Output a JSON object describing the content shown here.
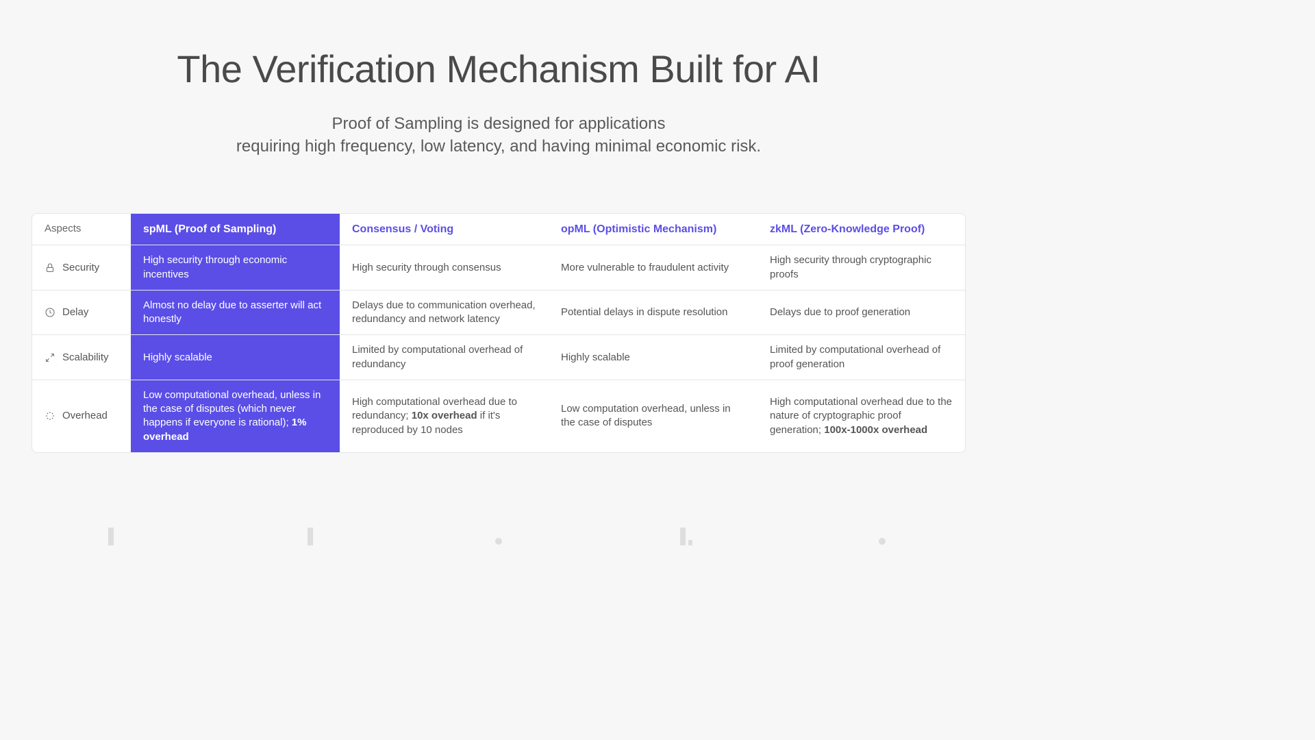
{
  "title": "The Verification Mechanism Built for AI",
  "subtitle_line1": "Proof of Sampling is designed for applications",
  "subtitle_line2": "requiring high frequency, low latency, and having minimal economic risk.",
  "table": {
    "header": {
      "aspects": "Aspects",
      "spml": "spML (Proof of Sampling)",
      "consensus": "Consensus / Voting",
      "opml": "opML (Optimistic Mechanism)",
      "zkml": "zkML (Zero-Knowledge Proof)"
    },
    "rows": {
      "security": {
        "label": "Security",
        "spml": "High security through economic incentives",
        "consensus": "High security through consensus",
        "opml": "More vulnerable to fraudulent activity",
        "zkml": "High security through cryptographic proofs"
      },
      "delay": {
        "label": "Delay",
        "spml": "Almost no delay due to asserter will act honestly",
        "consensus": "Delays due to communication overhead, redundancy and network latency",
        "opml": "Potential delays in dispute resolution",
        "zkml": "Delays due to proof generation"
      },
      "scalability": {
        "label": "Scalability",
        "spml": "Highly scalable",
        "consensus": "Limited by computational overhead of redundancy",
        "opml": "Highly scalable",
        "zkml": "Limited by computational overhead of proof generation"
      },
      "overhead": {
        "label": "Overhead",
        "spml_pre": "Low computational overhead, unless in the case of disputes (which never happens if everyone is rational); ",
        "spml_bold": "1% overhead",
        "consensus_pre": "High computational overhead due to redundancy; ",
        "consensus_bold": "10x overhead",
        "consensus_post": " if it's reproduced by 10 nodes",
        "opml": "Low computation overhead, unless in the case of disputes",
        "zkml_pre": "High computational overhead due to the nature of cryptographic proof generation; ",
        "zkml_bold": "100x-1000x overhead"
      }
    }
  }
}
